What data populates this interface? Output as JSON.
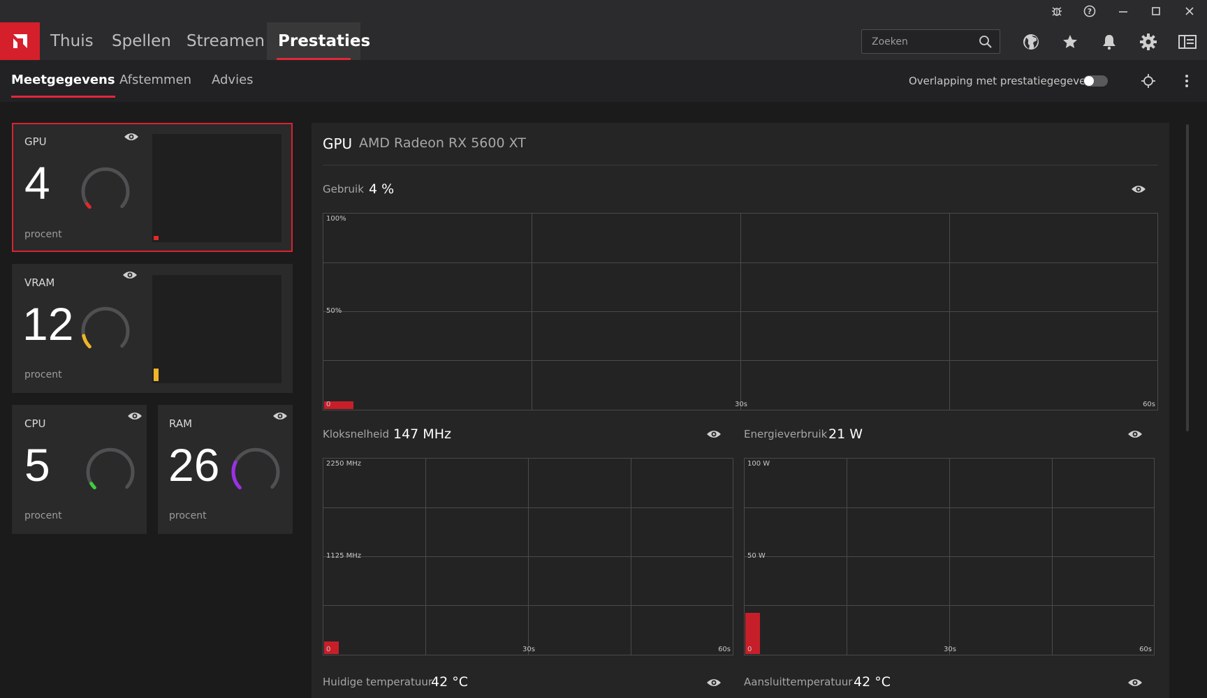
{
  "nav": {
    "tabs": [
      {
        "label": "Thuis"
      },
      {
        "label": "Spellen"
      },
      {
        "label": "Streamen"
      },
      {
        "label": "Prestaties"
      }
    ],
    "search_placeholder": "Zoeken"
  },
  "subnav": {
    "tabs": [
      {
        "label": "Meetgegevens"
      },
      {
        "label": "Afstemmen"
      },
      {
        "label": "Advies"
      }
    ],
    "overlay_label": "Overlapping met prestatiegegevens",
    "overlay_enabled": false
  },
  "cards": {
    "gpu": {
      "label": "GPU",
      "value": "4",
      "unit": "procent",
      "color": "#e02a2a",
      "fraction": 0.04
    },
    "vram": {
      "label": "VRAM",
      "value": "12",
      "unit": "procent",
      "color": "#f0b428",
      "fraction": 0.12
    },
    "cpu": {
      "label": "CPU",
      "value": "5",
      "unit": "procent",
      "color": "#3ccf3c",
      "fraction": 0.05
    },
    "ram": {
      "label": "RAM",
      "value": "26",
      "unit": "procent",
      "color": "#9b30e8",
      "fraction": 0.26
    }
  },
  "panel": {
    "title": "GPU",
    "device": "AMD Radeon RX 5600 XT",
    "usage": {
      "label": "Gebruik",
      "value": "4 %",
      "y_top": "100%",
      "y_mid": "50%",
      "y_zero": "0",
      "x_mid": "30s",
      "x_end": "60s",
      "fraction": 0.04
    },
    "clock": {
      "label": "Kloksnelheid",
      "value": "147 MHz",
      "y_top": "2250 MHz",
      "y_mid": "1125 MHz",
      "y_zero": "0",
      "x_mid": "30s",
      "x_end": "60s",
      "fraction": 0.065
    },
    "power": {
      "label": "Energieverbruik",
      "value": "21 W",
      "y_top": "100 W",
      "y_mid": "50 W",
      "y_zero": "0",
      "x_mid": "30s",
      "x_end": "60s",
      "fraction": 0.21
    },
    "temp": {
      "label": "Huidige temperatuur",
      "value": "42 °C"
    },
    "junction": {
      "label": "Aansluittemperatuur",
      "value": "42 °C"
    }
  },
  "colors": {
    "accent": "#e0283a",
    "amd_red": "#d51f2b",
    "bar": "#c71f2a"
  },
  "icons": [
    "bug-icon",
    "help-icon",
    "minimize-icon",
    "maximize-icon",
    "close-icon",
    "search-icon",
    "globe-icon",
    "star-icon",
    "bell-icon",
    "gear-icon",
    "sidebar-icon",
    "crosshair-icon",
    "more-vert-icon",
    "eye-icon"
  ]
}
